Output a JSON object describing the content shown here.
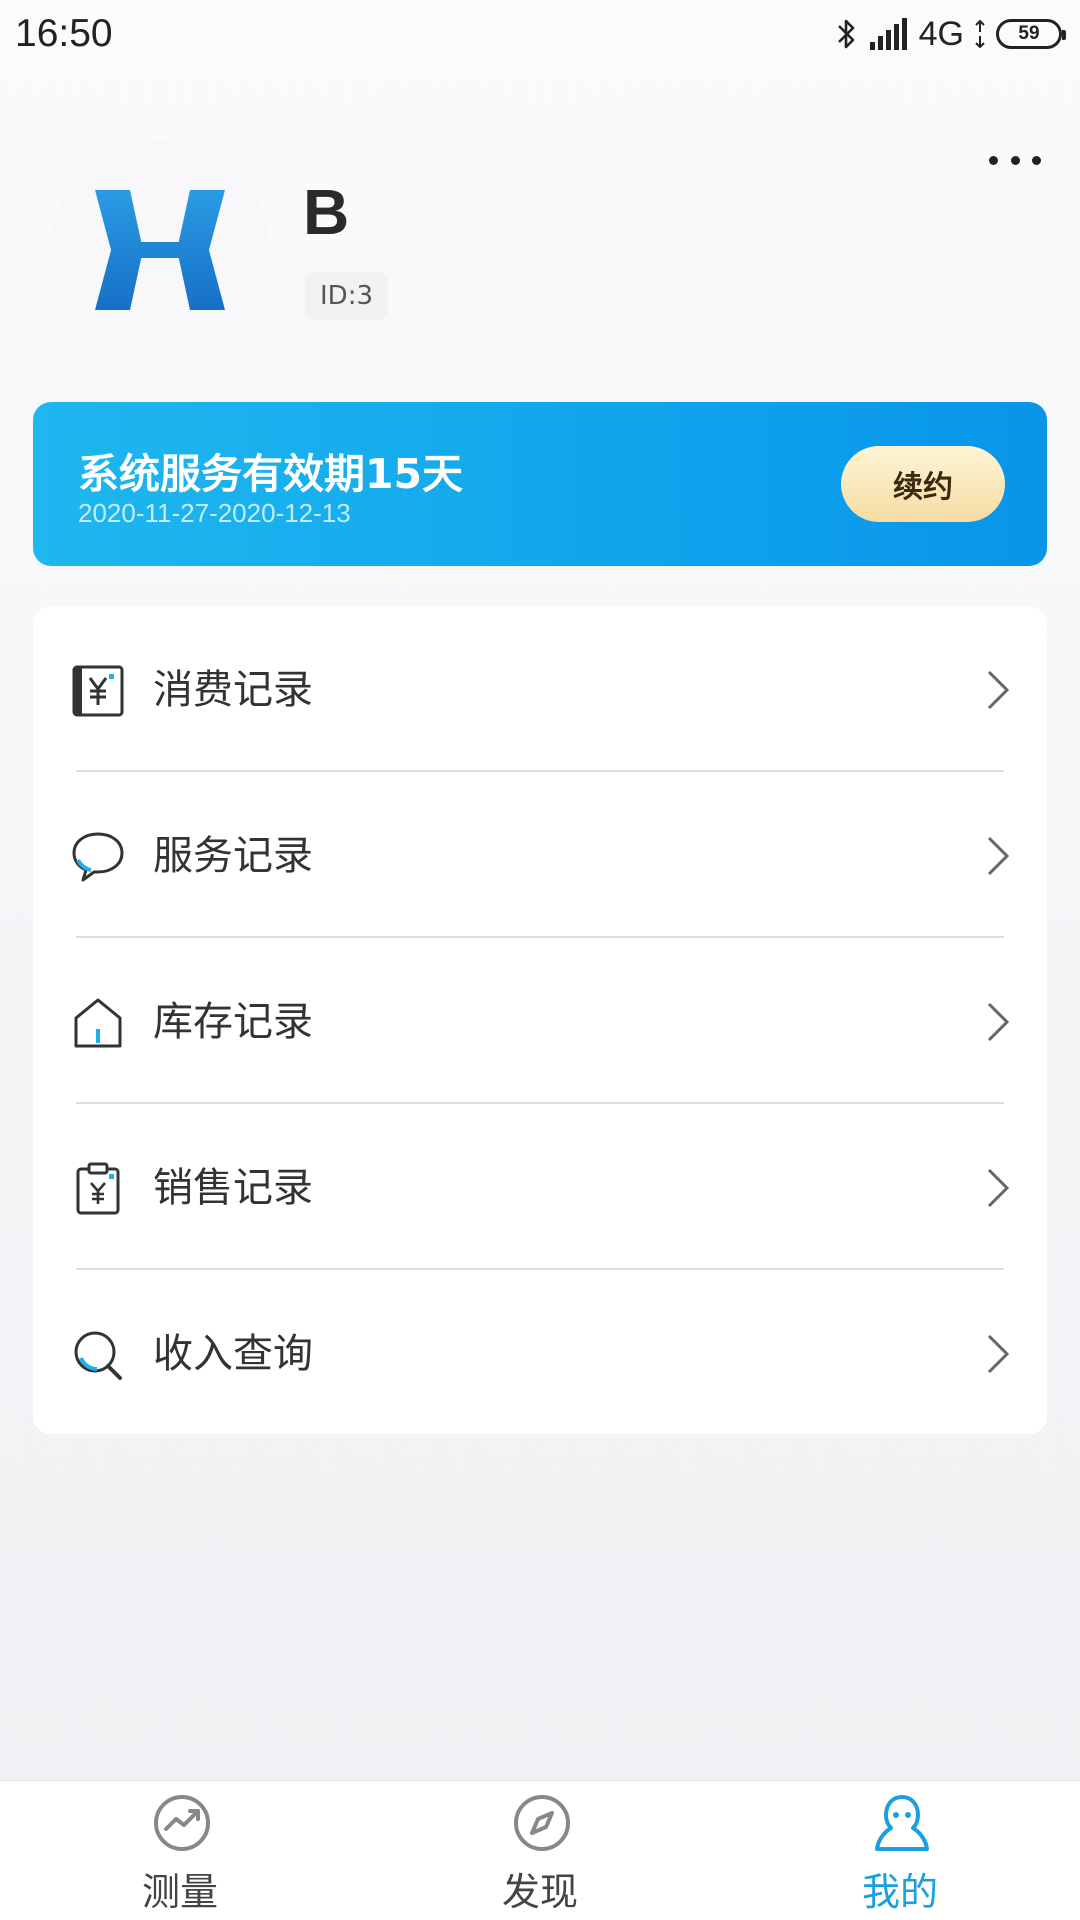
{
  "status_bar": {
    "time": "16:50",
    "network": "4G",
    "battery": "59"
  },
  "profile": {
    "name": "B",
    "id_label": "ID:3"
  },
  "service": {
    "title": "系统服务有效期15天",
    "dates": "2020-11-27-2020-12-13",
    "renew_label": "续约"
  },
  "menu": {
    "items": [
      {
        "label": "消费记录",
        "icon": "yuan-receipt-icon"
      },
      {
        "label": "服务记录",
        "icon": "chat-bubble-icon"
      },
      {
        "label": "库存记录",
        "icon": "house-icon"
      },
      {
        "label": "销售记录",
        "icon": "clipboard-yuan-icon"
      },
      {
        "label": "收入查询",
        "icon": "search-icon"
      }
    ]
  },
  "bottom_nav": {
    "items": [
      {
        "label": "测量",
        "icon": "trend-circle-icon",
        "active": false
      },
      {
        "label": "发现",
        "icon": "compass-icon",
        "active": false
      },
      {
        "label": "我的",
        "icon": "person-icon",
        "active": true
      }
    ]
  },
  "colors": {
    "accent": "#1a9fe0",
    "banner_start": "#1fb7ef",
    "banner_end": "#0895ea",
    "renew_gold": "#f6dca2"
  }
}
